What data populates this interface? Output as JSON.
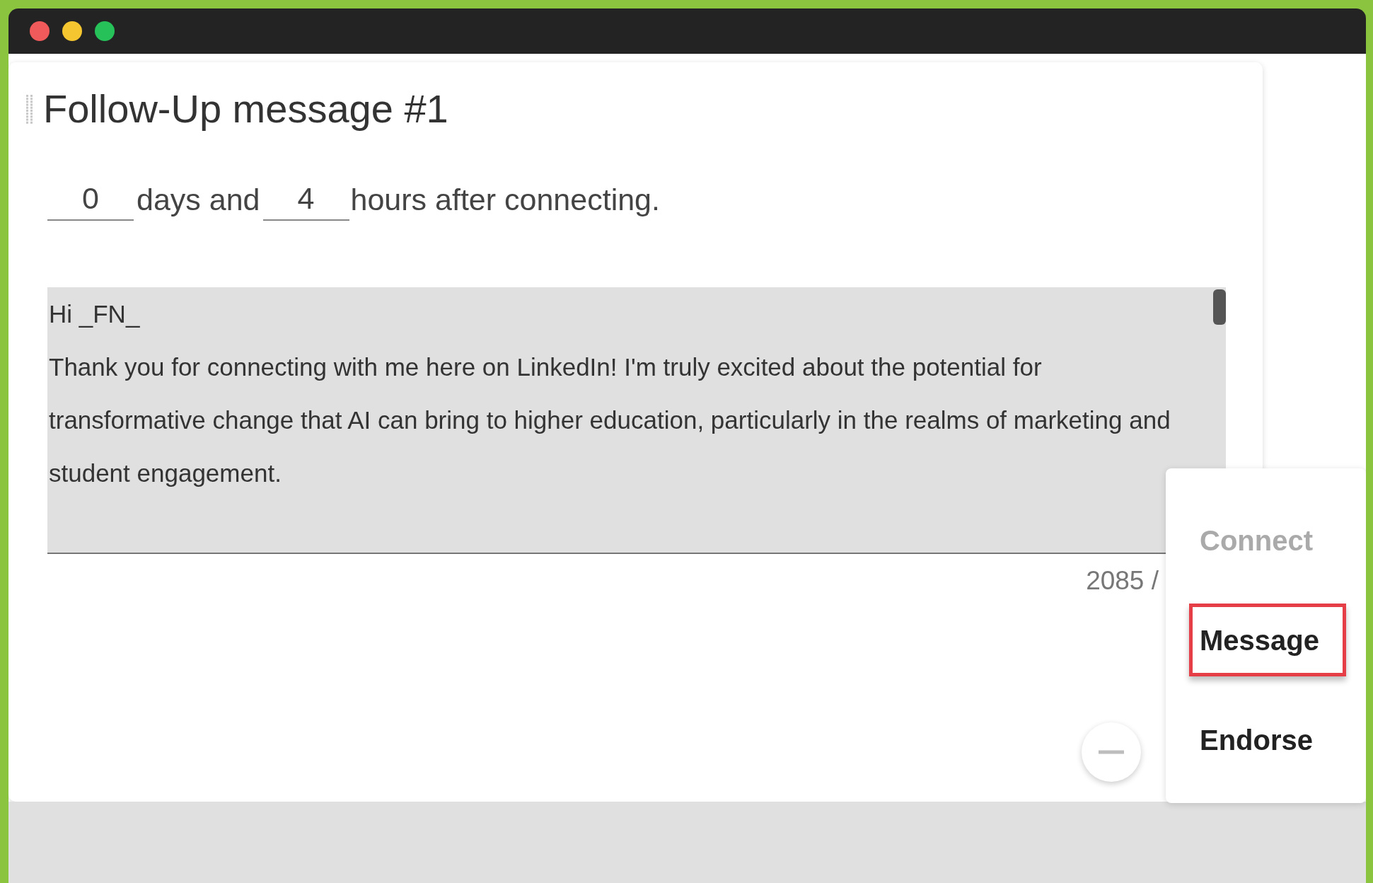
{
  "window": {
    "controls": [
      {
        "color": "#f05a5a"
      },
      {
        "color": "#f5c630"
      },
      {
        "color": "#27c15a"
      }
    ]
  },
  "card": {
    "title": "Follow-Up message #1",
    "delay": {
      "days": "0",
      "days_label": "days and",
      "hours": "4",
      "hours_label": "hours after connecting."
    },
    "message": {
      "value": "Hi _FN_\nThank you for connecting with me here on LinkedIn! I'm truly excited about the potential for transformative change that AI can bring to higher education, particularly in the realms of marketing and student engagement."
    },
    "counter": "2085 /"
  },
  "action_menu": {
    "items": [
      {
        "label": "Connect",
        "disabled": true,
        "selected": false
      },
      {
        "label": "Message",
        "disabled": false,
        "selected": true
      },
      {
        "label": "Endorse",
        "disabled": false,
        "selected": false
      }
    ]
  }
}
